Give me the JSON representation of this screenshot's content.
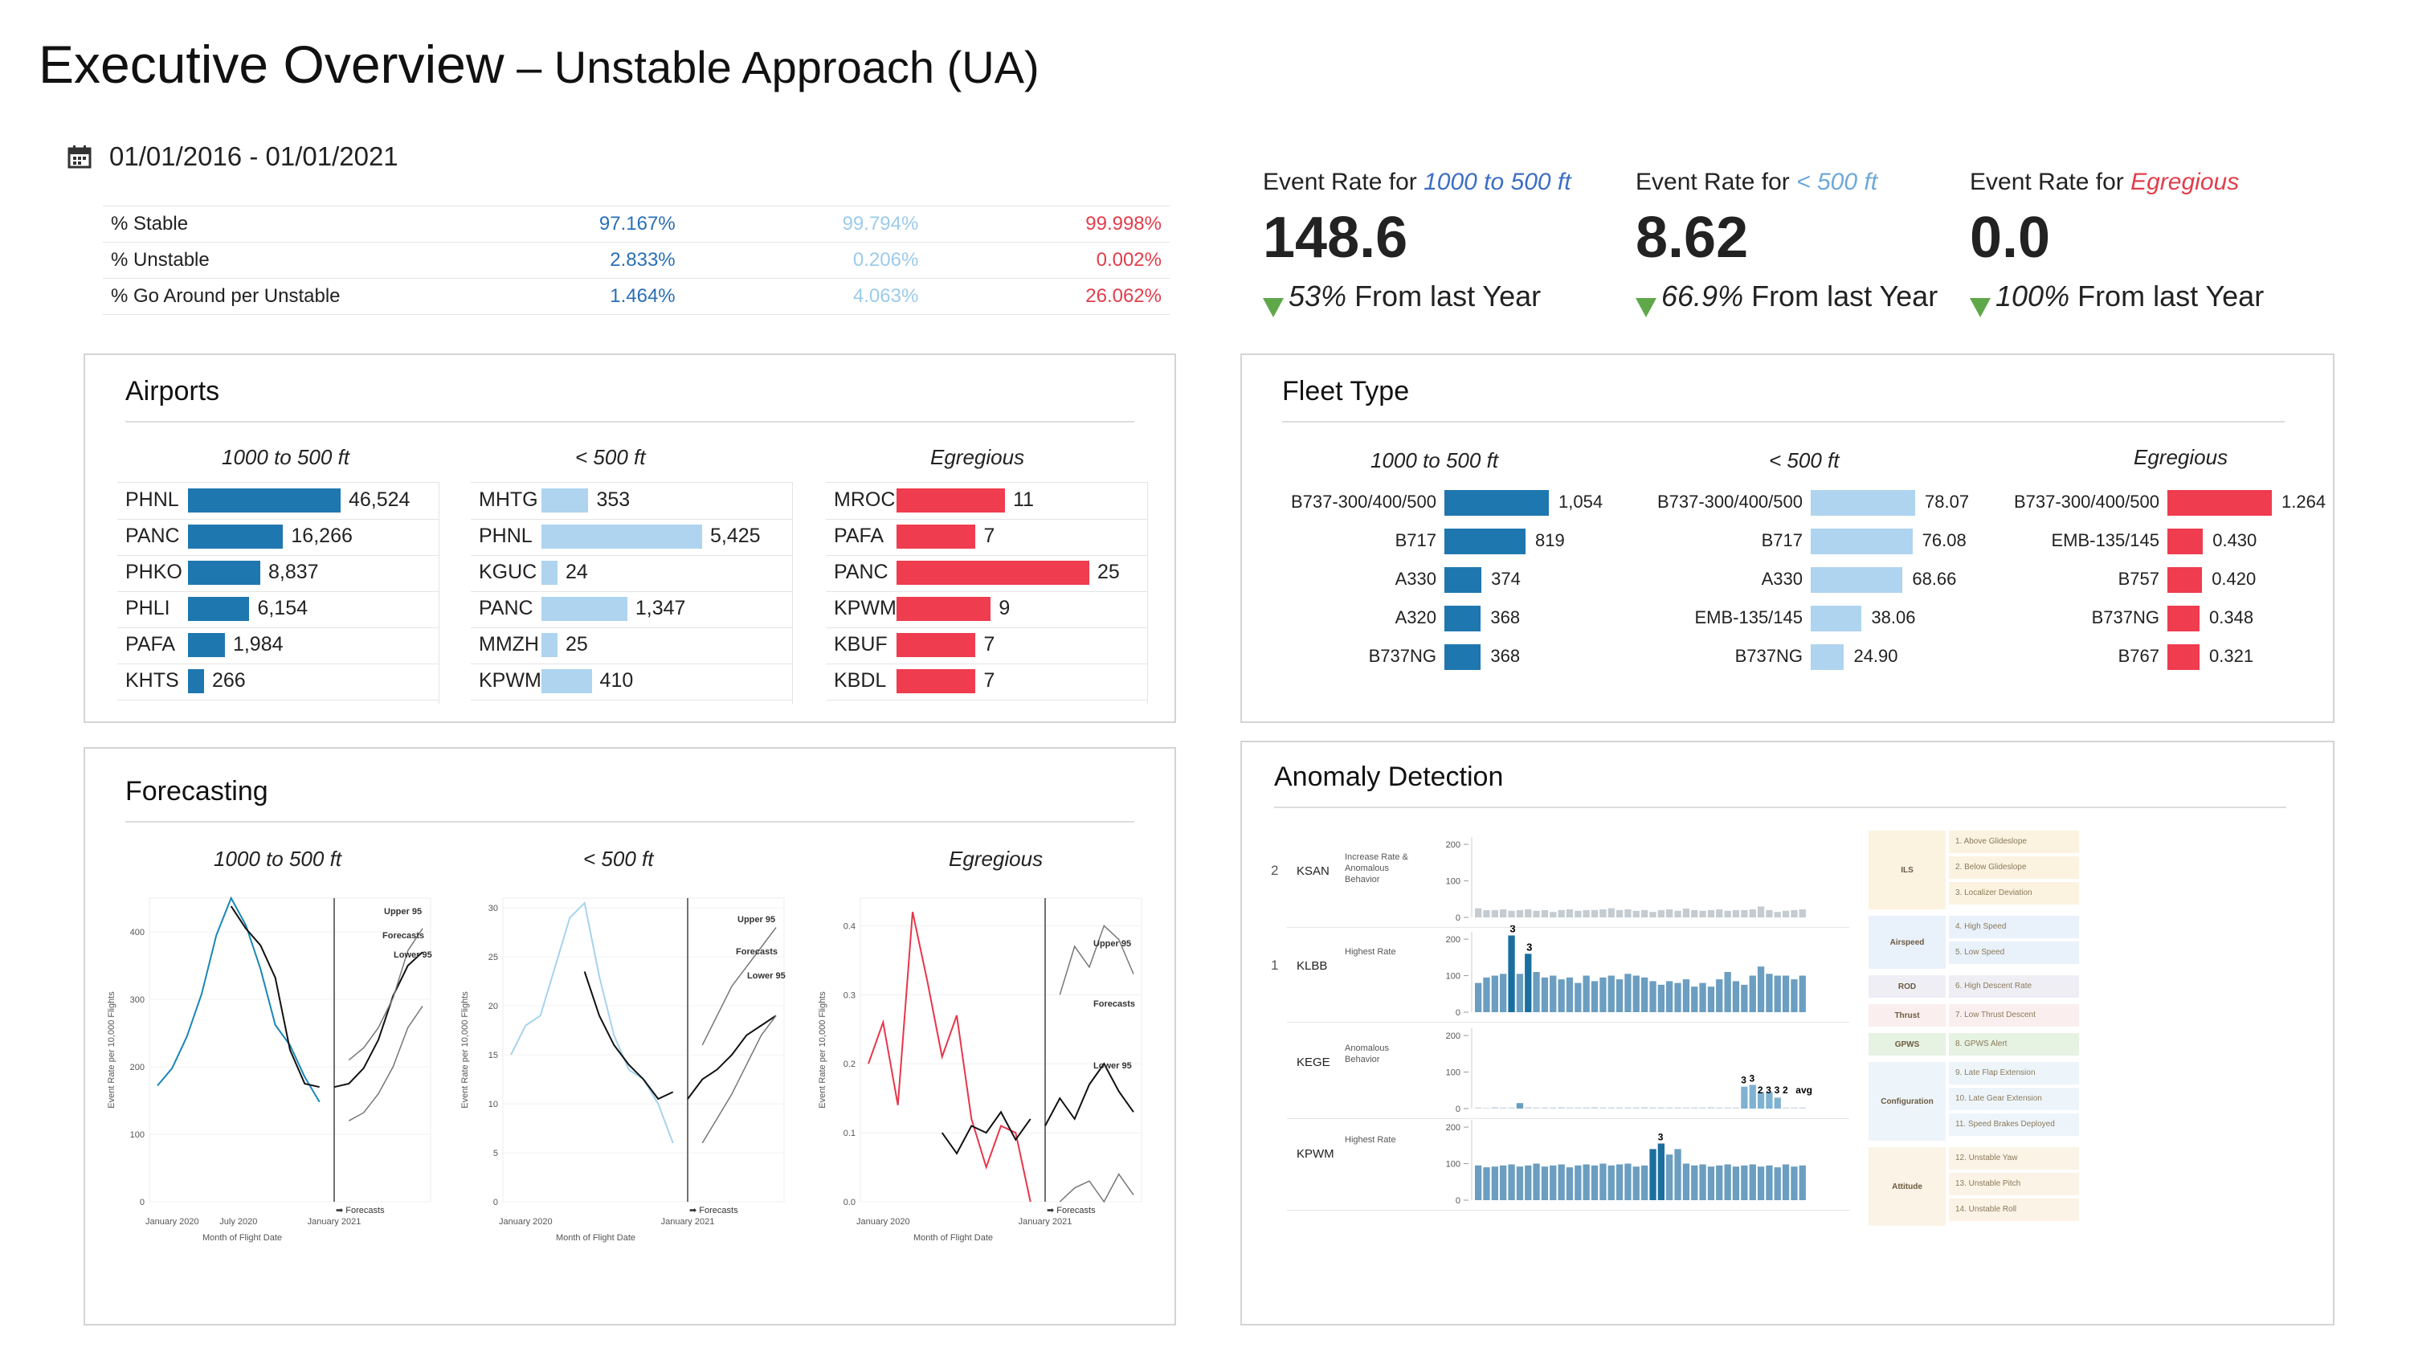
{
  "header": {
    "title": "Executive Overview",
    "subtitle": " – Unstable Approach (UA)",
    "date_range": "01/01/2016 - 01/01/2021",
    "icon": "calendar-icon"
  },
  "stats": [
    {
      "label": "% Stable",
      "v1": "97.167%",
      "v2": "99.794%",
      "v3": "99.998%"
    },
    {
      "label": "% Unstable",
      "v1": "2.833%",
      "v2": "0.206%",
      "v3": "0.002%"
    },
    {
      "label": "% Go Around per Unstable",
      "v1": "1.464%",
      "v2": "4.063%",
      "v3": "26.062%"
    }
  ],
  "kpis": [
    {
      "prefix": "Event Rate for ",
      "emph": "1000 to 500 ft",
      "color": "#3c6ec4",
      "value": "148.6",
      "change": "53%",
      "change_suffix": " From last Year"
    },
    {
      "prefix": "Event Rate for ",
      "emph": "< 500 ft",
      "color": "#6ea8dc",
      "value": "8.62",
      "change": "66.9%",
      "change_suffix": " From last Year"
    },
    {
      "prefix": "Event Rate for ",
      "emph": "Egregious",
      "color": "#e23d4b",
      "value": "0.0",
      "change": "100%",
      "change_suffix": " From last Year"
    }
  ],
  "colors": {
    "dark": "#1f77b0",
    "light": "#aed4ef",
    "red": "#ef3c4f",
    "series_dark": "#1a86b8",
    "series_light": "#a6d3ee"
  },
  "airports": {
    "title": "Airports",
    "groups": [
      {
        "title": "1000 to 500 ft",
        "rows": [
          {
            "code": "PHNL",
            "label": "46,524",
            "value": 46524
          },
          {
            "code": "PANC",
            "label": "16,266",
            "value": 16266
          },
          {
            "code": "PHKO",
            "label": "8,837",
            "value": 8837
          },
          {
            "code": "PHLI",
            "label": "6,154",
            "value": 6154
          },
          {
            "code": "PAFA",
            "label": "1,984",
            "value": 1984
          },
          {
            "code": "KHTS",
            "label": "266",
            "value": 266
          }
        ]
      },
      {
        "title": "< 500 ft",
        "rows": [
          {
            "code": "MHTG",
            "label": "353",
            "value": 353
          },
          {
            "code": "PHNL",
            "label": "5,425",
            "value": 5425
          },
          {
            "code": "KGUC",
            "label": "24",
            "value": 24
          },
          {
            "code": "PANC",
            "label": "1,347",
            "value": 1347
          },
          {
            "code": "MMZH",
            "label": "25",
            "value": 25
          },
          {
            "code": "KPWM",
            "label": "410",
            "value": 410
          }
        ]
      },
      {
        "title": "Egregious",
        "rows": [
          {
            "code": "MROC",
            "label": "11",
            "value": 11
          },
          {
            "code": "PAFA",
            "label": "7",
            "value": 7
          },
          {
            "code": "PANC",
            "label": "25",
            "value": 25
          },
          {
            "code": "KPWM",
            "label": "9",
            "value": 9
          },
          {
            "code": "KBUF",
            "label": "7",
            "value": 7
          },
          {
            "code": "KBDL",
            "label": "7",
            "value": 7
          }
        ]
      }
    ]
  },
  "fleet": {
    "title": "Fleet Type",
    "groups": [
      {
        "title": "1000 to 500 ft",
        "rows": [
          {
            "code": "B737-300/400/500",
            "label": "1,054",
            "value": 1054
          },
          {
            "code": "B717",
            "label": "819",
            "value": 819
          },
          {
            "code": "A330",
            "label": "374",
            "value": 374
          },
          {
            "code": "A320",
            "label": "368",
            "value": 368
          },
          {
            "code": "B737NG",
            "label": "368",
            "value": 368
          }
        ]
      },
      {
        "title": "< 500 ft",
        "rows": [
          {
            "code": "B737-300/400/500",
            "label": "78.07",
            "value": 78.07
          },
          {
            "code": "B717",
            "label": "76.08",
            "value": 76.08
          },
          {
            "code": "A330",
            "label": "68.66",
            "value": 68.66
          },
          {
            "code": "EMB-135/145",
            "label": "38.06",
            "value": 38.06
          },
          {
            "code": "B737NG",
            "label": "24.90",
            "value": 24.9
          }
        ]
      },
      {
        "title": "Egregious",
        "rows": [
          {
            "code": "B737-300/400/500",
            "label": "1.264",
            "value": 1.264
          },
          {
            "code": "EMB-135/145",
            "label": "0.430",
            "value": 0.43
          },
          {
            "code": "B757",
            "label": "0.420",
            "value": 0.42
          },
          {
            "code": "B737NG",
            "label": "0.348",
            "value": 0.348
          },
          {
            "code": "B767",
            "label": "0.321",
            "value": 0.321
          }
        ]
      }
    ]
  },
  "forecasting": {
    "title": "Forecasting",
    "charts": [
      {
        "title": "1000 to 500 ft",
        "ylabel": "Event Rate per 10,000 Flights",
        "xlabel": "Month of Flight Date",
        "yticks": [
          "0",
          "100",
          "200",
          "300",
          "400"
        ],
        "ymax": 450,
        "xticks": [
          "January 2020",
          "July 2020",
          "January 2021"
        ],
        "labels": [
          "Upper 95",
          "Forecasts",
          "Lower 95"
        ],
        "footer": "➡ Forecasts",
        "actual": [
          172,
          198,
          245,
          308,
          395,
          450,
          410,
          345,
          262,
          232,
          185,
          148
        ],
        "fitted": [
          438,
          405,
          380,
          332,
          225,
          175,
          170
        ],
        "forecast": [
          170,
          175,
          198,
          240,
          305,
          350,
          370
        ],
        "upper": [
          210,
          228,
          258,
          302,
          372,
          405
        ],
        "lower": [
          120,
          132,
          160,
          200,
          258,
          290
        ]
      },
      {
        "title": "< 500 ft",
        "ylabel": "Event Rate per 10,000 Flights",
        "xlabel": "Month of Flight Date",
        "yticks": [
          "0",
          "5",
          "10",
          "15",
          "20",
          "25",
          "30"
        ],
        "ymax": 31,
        "xticks": [
          "January 2020",
          "January 2021"
        ],
        "labels": [
          "Upper 95",
          "Forecasts",
          "Lower 95"
        ],
        "footer": "➡ Forecasts",
        "actual": [
          15,
          18,
          19,
          24,
          29,
          30.5,
          23,
          17,
          13.5,
          12.5,
          10,
          6
        ],
        "fitted": [
          23.5,
          19,
          16,
          14,
          12.5,
          10.5,
          11.2
        ],
        "forecast": [
          10.5,
          12.5,
          13.5,
          15,
          17,
          18,
          19
        ],
        "upper": [
          16,
          19,
          22,
          24,
          26,
          28
        ],
        "lower": [
          6,
          8.5,
          11,
          14,
          17,
          19
        ],
        "min_label": "0"
      },
      {
        "title": "Egregious",
        "ylabel": "Event Rate per 10,000 Flights",
        "xlabel": "Month of Flight Date",
        "yticks": [
          "0.0",
          "0.1",
          "0.2",
          "0.3",
          "0.4"
        ],
        "ymax": 0.44,
        "xticks": [
          "January 2020",
          "January 2021"
        ],
        "labels": [
          "Upper 95",
          "Forecasts",
          "Lower 95"
        ],
        "footer": "➡ Forecasts",
        "actual": [
          0.2,
          0.26,
          0.14,
          0.42,
          0.32,
          0.21,
          0.27,
          0.12,
          0.05,
          0.11,
          0.1,
          0.0
        ],
        "fitted": [
          0.1,
          0.07,
          0.11,
          0.1,
          0.13,
          0.09,
          0.12
        ],
        "forecast": [
          0.11,
          0.15,
          0.12,
          0.17,
          0.2,
          0.16,
          0.13
        ],
        "upper": [
          0.3,
          0.37,
          0.34,
          0.4,
          0.38,
          0.33
        ],
        "lower": [
          0.0,
          0.02,
          0.03,
          0.0,
          0.04,
          0.01
        ]
      }
    ]
  },
  "anomaly": {
    "title": "Anomaly Detection",
    "rows": [
      {
        "rank": "2",
        "airport": "KSAN",
        "reason": "Increase Rate & Anomalous Behavior",
        "values": [
          25,
          20,
          20,
          22,
          18,
          20,
          22,
          18,
          20,
          15,
          20,
          22,
          18,
          20,
          20,
          22,
          25,
          20,
          22,
          18,
          20,
          15,
          20,
          22,
          18,
          24,
          20,
          18,
          20,
          22,
          18,
          20,
          20,
          22,
          30,
          20,
          15,
          18,
          20,
          22
        ],
        "highlights": [],
        "labels": []
      },
      {
        "rank": "1",
        "airport": "KLBB",
        "reason": "Highest Rate",
        "values": [
          80,
          95,
          100,
          105,
          210,
          105,
          160,
          110,
          95,
          100,
          90,
          95,
          80,
          100,
          85,
          95,
          100,
          90,
          105,
          100,
          95,
          85,
          75,
          85,
          80,
          90,
          70,
          80,
          70,
          90,
          110,
          85,
          75,
          100,
          125,
          105,
          100,
          100,
          90,
          100
        ],
        "highlights": [
          4,
          6
        ],
        "labels": [
          "3",
          "3"
        ]
      },
      {
        "rank": "",
        "airport": "KEGE",
        "reason": "Anomalous Behavior",
        "values": [
          3,
          2,
          4,
          3,
          3,
          15,
          4,
          3,
          3,
          3,
          4,
          3,
          3,
          3,
          4,
          3,
          3,
          3,
          3,
          3,
          4,
          3,
          3,
          3,
          3,
          3,
          3,
          3,
          4,
          3,
          3,
          3,
          60,
          65,
          45,
          45,
          30,
          3,
          3,
          3
        ],
        "highlights": [],
        "labels": [
          "3",
          "3",
          "2",
          "3",
          "3",
          "2",
          "avg"
        ]
      },
      {
        "rank": "",
        "airport": "KPWM",
        "reason": "Highest Rate",
        "values": [
          95,
          90,
          92,
          95,
          98,
          92,
          95,
          100,
          92,
          95,
          98,
          90,
          95,
          98,
          95,
          100,
          95,
          98,
          100,
          92,
          95,
          140,
          155,
          125,
          140,
          100,
          95,
          98,
          92,
          95,
          98,
          92,
          95,
          98,
          92,
          95,
          90,
          98,
          92,
          95
        ],
        "highlights": [
          21,
          22
        ],
        "labels": [
          "3"
        ]
      }
    ],
    "yticks": [
      "0",
      "100",
      "200"
    ],
    "categories": [
      {
        "group": "ILS",
        "items": [
          "1. Above Glideslope",
          "2. Below Glideslope",
          "3. Localizer Deviation"
        ],
        "bg": "#fbf3e0"
      },
      {
        "group": "Airspeed",
        "items": [
          "4. High Speed",
          "5. Low Speed"
        ],
        "bg": "#e9f1fb"
      },
      {
        "group": "ROD",
        "items": [
          "6. High Descent Rate"
        ],
        "bg": "#efeef5"
      },
      {
        "group": "Thrust",
        "items": [
          "7. Low Thrust Descent"
        ],
        "bg": "#fbeeee"
      },
      {
        "group": "GPWS",
        "items": [
          "8. GPWS Alert"
        ],
        "bg": "#e6f2e2"
      },
      {
        "group": "Configuration",
        "items": [
          "9. Late Flap Extension",
          "10. Late Gear Extension",
          "11. Speed Brakes Deployed"
        ],
        "bg": "#edf5fb"
      },
      {
        "group": "Attitude",
        "items": [
          "12. Unstable Yaw",
          "13. Unstable Pitch",
          "14. Unstable Roll"
        ],
        "bg": "#fbf3e6"
      }
    ]
  }
}
